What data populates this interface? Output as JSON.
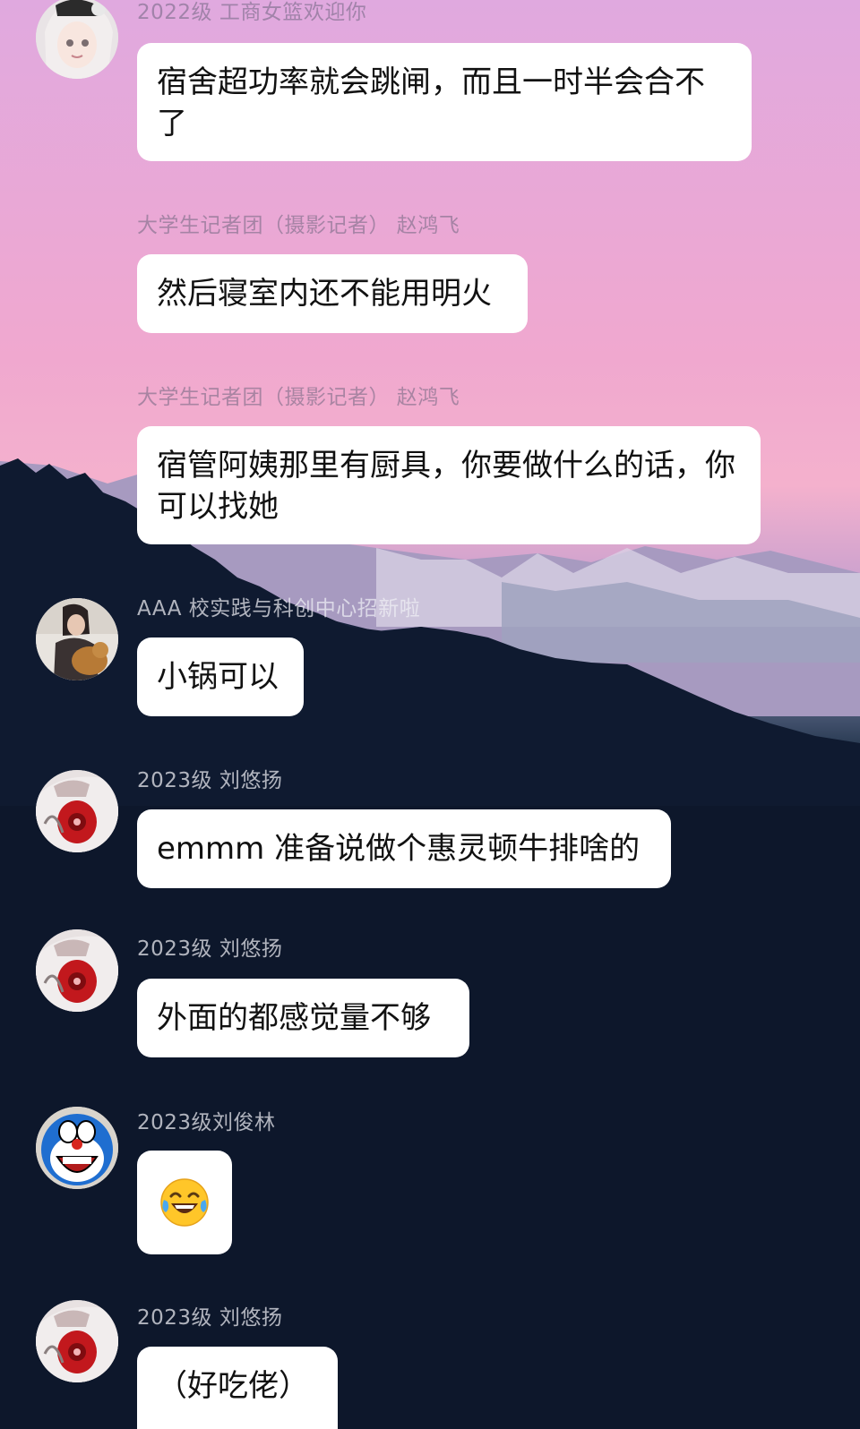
{
  "chat": {
    "messages": [
      {
        "sender": "2022级 工商女篮欢迎你",
        "text": "宿舍超功率就会跳闸，而且一时半会合不了",
        "avatar": "anime-girl-avatar"
      },
      {
        "sender": "大学生记者团（摄影记者） 赵鸿飞",
        "text": "然后寝室内还不能用明火",
        "avatar": ""
      },
      {
        "sender": "大学生记者团（摄影记者） 赵鸿飞",
        "text": "宿管阿姨那里有厨具，你要做什么的话，你可以找她",
        "avatar": ""
      },
      {
        "sender": "AAA 校实践与科创中心招新啦",
        "text": "小锅可以",
        "avatar": "photo-avatar"
      },
      {
        "sender": "2023级 刘悠扬",
        "text": "emmm 准备说做个惠灵顿牛排啥的",
        "avatar": "anime-red-avatar"
      },
      {
        "sender": "2023级 刘悠扬",
        "text": "外面的都感觉量不够",
        "avatar": "anime-red-avatar"
      },
      {
        "sender": "2023级刘俊林",
        "text": "",
        "emoji": "laughing-tears-emoji",
        "avatar": "doraemon-avatar"
      },
      {
        "sender": "2023级 刘悠扬",
        "text": "（好吃佬）",
        "avatar": "anime-red-avatar"
      }
    ]
  },
  "colors": {
    "bubble": "#ffffff",
    "sky_top": "#e0a9df",
    "night": "#0b1428"
  }
}
